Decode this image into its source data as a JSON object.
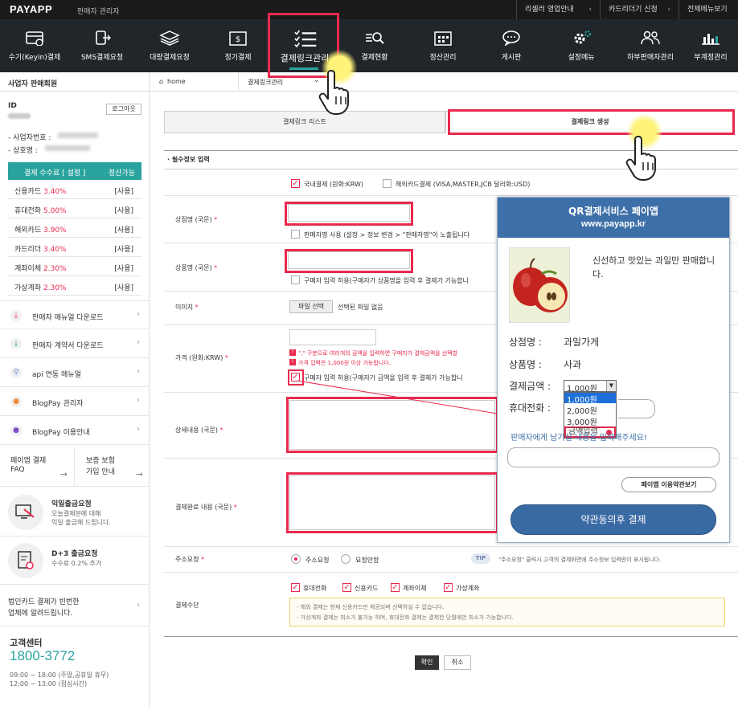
{
  "header": {
    "logo": "PAYAPP",
    "subtitle": "판매자 관리자",
    "links": [
      "리셀러 영업안내",
      "카드리더기 신청",
      "전체메뉴보기"
    ]
  },
  "nav": [
    {
      "label": "수기(Keyin)결제",
      "icon": "card-icon"
    },
    {
      "label": "SMS결제요청",
      "icon": "sms-icon"
    },
    {
      "label": "대량결제요청",
      "icon": "layers-icon"
    },
    {
      "label": "정기결제",
      "icon": "calendar-money-icon"
    },
    {
      "label": "결제링크관리",
      "icon": "list-check-icon"
    },
    {
      "label": "결제현황",
      "icon": "search-list-icon"
    },
    {
      "label": "정산관리",
      "icon": "calendar-grid-icon"
    },
    {
      "label": "게시판",
      "icon": "chat-icon"
    },
    {
      "label": "설정메뉴",
      "icon": "gear-icon"
    },
    {
      "label": "하부판매자관리",
      "icon": "users-icon"
    },
    {
      "label": "부계정관리",
      "icon": "bar-chart-icon"
    }
  ],
  "sidebar": {
    "title": "사업자 판매회원",
    "id_label": "ID",
    "logout": "로그아웃",
    "biz_no_label": "- 사업자번호 :",
    "trade_name_label": "- 상호명 :",
    "fee_header": "결제 수수료 [ 설정 ]",
    "fee_header_right": "정산가능",
    "fees": [
      {
        "name": "신용카드",
        "rate": "3.40%",
        "status": "[사용]"
      },
      {
        "name": "휴대전화",
        "rate": "5.00%",
        "status": "[사용]"
      },
      {
        "name": "해외카드",
        "rate": "3.90%",
        "status": "[사용]"
      },
      {
        "name": "카드리더",
        "rate": "3.40%",
        "status": "[사용]"
      },
      {
        "name": "계좌이체",
        "rate": "2.30%",
        "status": "[사용]"
      },
      {
        "name": "가상계좌",
        "rate": "2.30%",
        "status": "[사용]"
      }
    ],
    "menus": [
      "판매자 매뉴얼 다운로드",
      "판매자 계약서 다운로드",
      "api 연동 매뉴얼",
      "BlogPay 관리자",
      "BlogPay 이용안내"
    ],
    "faq1": "페이앱 결제",
    "faq1b": "FAQ",
    "faq2": "보증 보험",
    "faq2b": "가입 안내",
    "promo1_title": "익일출금요청",
    "promo1_l1": "오늘결제분에 대해",
    "promo1_l2": "익일 출금해 드립니다.",
    "promo2_title": "D+3 출금요청",
    "promo2_l1": "수수료 0.2% 추가",
    "corp_l1": "법인카드 결제가 빈번한",
    "corp_l2": "업체에 알려드립니다.",
    "cs_title": "고객센터",
    "cs_phone": "1800-3772",
    "cs_h1": "09:00 ~ 18:00 (주말,공휴일 휴무)",
    "cs_h2": "12:00 ~ 13:00 (점심시간)"
  },
  "breadcrumb": {
    "home": "home",
    "current": "결제링크관리"
  },
  "tabs": {
    "list": "결제링크 리스트",
    "create": "결제링크 생성"
  },
  "form": {
    "section": "· 필수정보 입력",
    "domestic": "국내결제 (원화:KRW)",
    "overseas": "해외카드결제 (VISA,MASTER,JCB 달러화:USD)",
    "store_label": "상점명 (국문)",
    "store_opt": "판매자명 사용 (설정 > 정보 변경 > \"판매자명\"이 노출됩니다",
    "product_label": "상품명 (국문)",
    "product_opt": "구매자 입력 허용(구매자가 상품명을 입력 후 결제가 가능합니",
    "image_label": "이미지",
    "file_btn": "파일 선택",
    "file_none": "선택된 파일 없음",
    "price_label": "가격 (원화:KRW)",
    "price_note1": "\",\" 구분으로 여러개의 금액을 입력하면 구매자가 결제금액을 선택할",
    "price_note2": "가격 입력은 1,000원 이상 가능합니다.",
    "price_opt": "구매자 입력 허용(구매자가 금액을 입력 후 결제가 가능합니",
    "detail_label": "상세내용 (국문)",
    "complete_label": "결제완료 내용 (국문)",
    "addr_label": "주소요청",
    "addr_yes": "주소요청",
    "addr_no": "요청안함",
    "tip": "TIP",
    "tip_text": "\"주소요청\" 클릭시 고객의 결제화면에 주소정보 입력란이 표시됩니다.",
    "method_label": "결제수단",
    "methods": [
      "휴대전화",
      "신용카드",
      "계좌이체",
      "가상계좌"
    ],
    "note1": "- 해외 결제는 현재 신용카드만 제공되며 선택하실 수 없습니다.",
    "note2": "- 가상계좌 결제는 취소가 불가능 하며, 휴대전화 결제는 결제한 당월에만 취소가 가능합니다.",
    "ok": "확인",
    "cancel": "취소"
  },
  "popup": {
    "title": "QR결제서비스 페이앱",
    "url": "www.payapp.kr",
    "desc": "신선하고 맛있는 과일만 판매합니다.",
    "store_label": "상점명 :",
    "store": "과일가게",
    "product_label": "상품명 :",
    "product": "사과",
    "amount_label": "결제금액 :",
    "amount_selected": "1,000원",
    "options": [
      "1,000원",
      "2,000원",
      "3,000원",
      "금액입력"
    ],
    "phone_label": "휴대전화 :",
    "memo_prompt": "판매자에게 남기실 내용을 입력해주세요!",
    "terms_btn": "페이앱 이용약관보기",
    "pay_btn": "약관동의후 결제"
  },
  "colors": {
    "accent": "#e8294f",
    "teal": "#2aa39e",
    "nav_bg": "#20262a",
    "popup_blue": "#3d6fa8",
    "pay_btn": "#3a6aa3"
  }
}
